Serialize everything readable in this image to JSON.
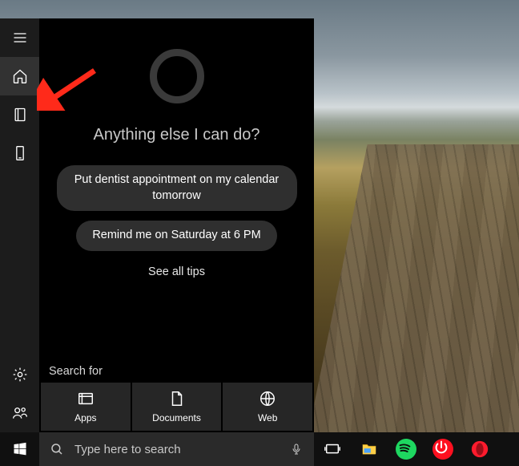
{
  "cortana": {
    "greeting": "Anything else I can do?",
    "suggestions": [
      "Put dentist appointment on my calendar tomorrow",
      "Remind me on Saturday at 6 PM"
    ],
    "see_tips": "See all tips",
    "search_for_label": "Search for",
    "categories": [
      {
        "label": "Apps",
        "icon": "apps"
      },
      {
        "label": "Documents",
        "icon": "document"
      },
      {
        "label": "Web",
        "icon": "globe"
      }
    ],
    "sidebar": {
      "top": [
        {
          "name": "menu",
          "icon": "hamburger"
        },
        {
          "name": "home",
          "icon": "home",
          "active": true
        },
        {
          "name": "notebook",
          "icon": "notebook"
        },
        {
          "name": "devices",
          "icon": "device"
        }
      ],
      "bottom": [
        {
          "name": "settings",
          "icon": "gear"
        },
        {
          "name": "feedback",
          "icon": "feedback"
        }
      ]
    }
  },
  "taskbar": {
    "search_placeholder": "Type here to search",
    "buttons": [
      {
        "name": "task-view",
        "icon": "taskview"
      },
      {
        "name": "file-explorer",
        "icon": "explorer",
        "color": "#ffcf48"
      },
      {
        "name": "spotify",
        "icon": "circle",
        "color": "#1ed760"
      },
      {
        "name": "power",
        "icon": "power",
        "color": "#ff1020"
      },
      {
        "name": "opera",
        "icon": "opera",
        "color": "#ff1b2d"
      }
    ]
  },
  "annotation": {
    "arrow_color": "#ff2a1a"
  }
}
